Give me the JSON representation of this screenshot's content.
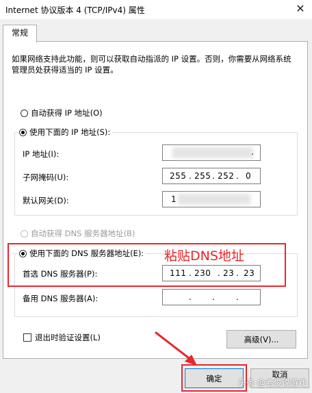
{
  "window": {
    "title": "Internet 协议版本 4 (TCP/IPv4) 属性",
    "close_glyph": "✕"
  },
  "tabs": [
    {
      "label": "常规"
    }
  ],
  "description": "如果网络支持此功能，则可以获取自动指派的 IP 设置。否则，你需要从网络系统管理员处获得适当的 IP 设置。",
  "ip_section": {
    "auto_label": "自动获得 IP 地址(O)",
    "manual_label": "使用下面的 IP 地址(S):",
    "ip_label": "IP 地址(I):",
    "ip_value": ".",
    "subnet_label": "子网掩码(U):",
    "subnet_octets": [
      "255",
      "255",
      "252",
      "0"
    ],
    "gateway_label": "默认网关(D):",
    "gateway_value": "1"
  },
  "dns_section": {
    "auto_label": "自动获得 DNS 服务器地址(B)",
    "manual_label": "使用下面的 DNS 服务器地址(E):",
    "preferred_label": "首选 DNS 服务器(P):",
    "preferred_octets": [
      "111",
      "230",
      "23",
      "23"
    ],
    "alternate_label": "备用 DNS 服务器(A):",
    "alternate_octets": [
      "",
      "",
      "",
      ""
    ]
  },
  "validate_label": "退出时验证设置(L)",
  "advanced_label": "高级(V)...",
  "ok_label": "确定",
  "cancel_label": "取消",
  "annotation_text": "粘贴DNS地址",
  "watermark_text": "头条 @老俊说游戏",
  "colors": {
    "annotation": "#e8262b",
    "dialog_bg": "#f0f0f0",
    "panel_bg": "#ffffff"
  }
}
